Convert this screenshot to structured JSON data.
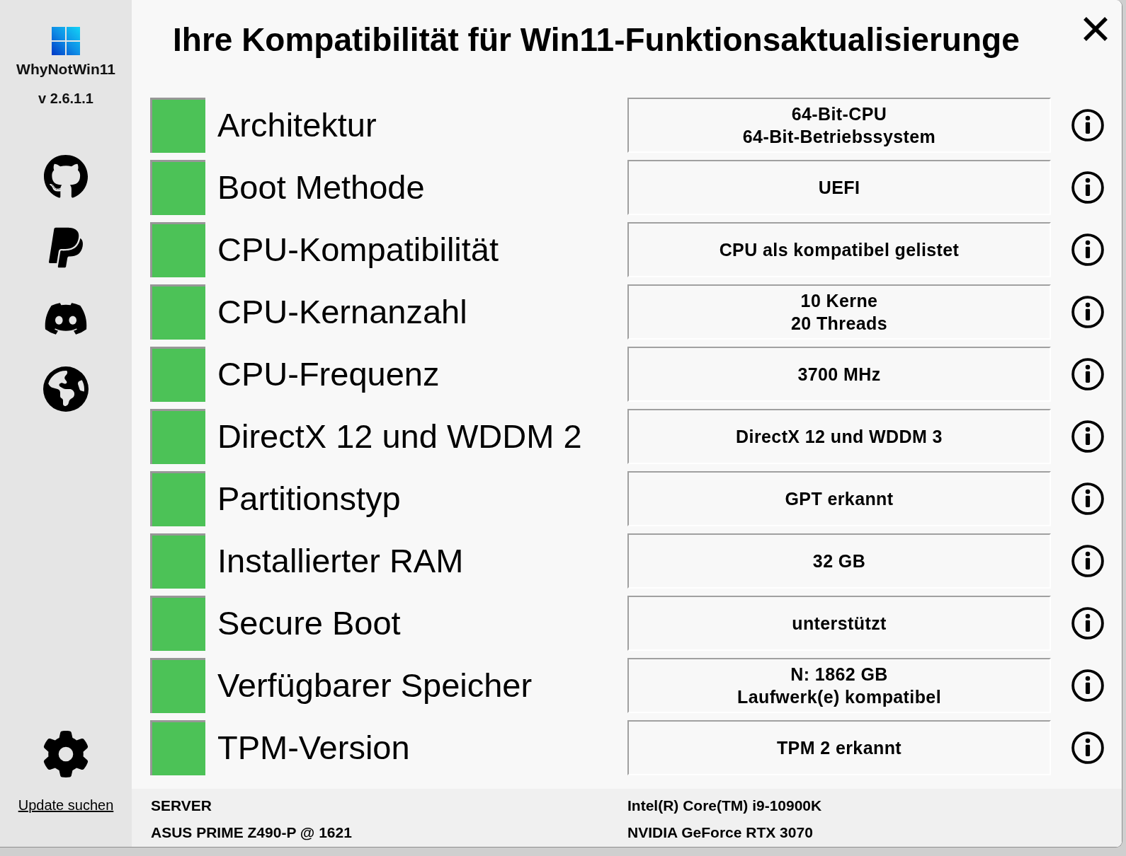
{
  "sidebar": {
    "app_name": "WhyNotWin11",
    "version": "v 2.6.1.1",
    "update_link": "Update suchen"
  },
  "title": "Ihre Kompatibilität für Win11-Funktionsaktualisierunge",
  "checks": [
    {
      "label": "Architektur",
      "passed": true,
      "details": [
        "64-Bit-CPU",
        "64-Bit-Betriebssystem"
      ]
    },
    {
      "label": "Boot Methode",
      "passed": true,
      "details": [
        "UEFI"
      ]
    },
    {
      "label": "CPU-Kompatibilität",
      "passed": true,
      "details": [
        "CPU als kompatibel gelistet"
      ]
    },
    {
      "label": "CPU-Kernanzahl",
      "passed": true,
      "details": [
        "10 Kerne",
        "20 Threads"
      ]
    },
    {
      "label": "CPU-Frequenz",
      "passed": true,
      "details": [
        "3700 MHz"
      ]
    },
    {
      "label": "DirectX 12 und WDDM 2",
      "passed": true,
      "details": [
        "DirectX 12 und WDDM 3"
      ]
    },
    {
      "label": "Partitionstyp",
      "passed": true,
      "details": [
        "GPT erkannt"
      ]
    },
    {
      "label": "Installierter RAM",
      "passed": true,
      "details": [
        "32 GB"
      ]
    },
    {
      "label": "Secure Boot",
      "passed": true,
      "details": [
        "unterstützt"
      ]
    },
    {
      "label": "Verfügbarer Speicher",
      "passed": true,
      "details": [
        "N: 1862 GB",
        "Laufwerk(e) kompatibel"
      ]
    },
    {
      "label": "TPM-Version",
      "passed": true,
      "details": [
        "TPM 2 erkannt"
      ]
    }
  ],
  "system_info": {
    "computer_name": "SERVER",
    "cpu": "Intel(R) Core(TM) i9-10900K",
    "motherboard": "ASUS PRIME Z490-P @ 1621",
    "gpu": "NVIDIA GeForce RTX 3070"
  }
}
